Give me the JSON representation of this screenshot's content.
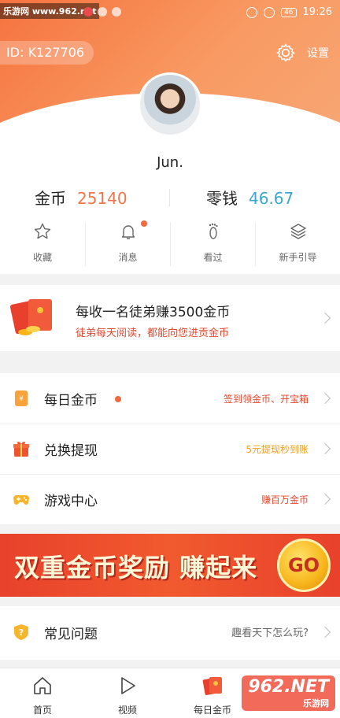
{
  "status_bar": {
    "watermark": "乐游网 www.962.net",
    "time": "19:26",
    "battery": "46"
  },
  "header": {
    "user_id": "ID: K127706",
    "settings_label": "设置"
  },
  "profile": {
    "username": "Jun.",
    "coins_label": "金币",
    "coins_value": "25140",
    "change_label": "零钱",
    "change_value": "46.67",
    "colors": {
      "coins": "#f0764c",
      "change": "#3ba7d4"
    }
  },
  "quick_actions": [
    {
      "label": "收藏",
      "icon": "star-icon"
    },
    {
      "label": "消息",
      "icon": "bell-icon"
    },
    {
      "label": "看过",
      "icon": "footprint-icon"
    },
    {
      "label": "新手引导",
      "icon": "layers-icon"
    }
  ],
  "invite": {
    "title": "每收一名徒弟赚3500金币",
    "subtitle": "徒弟每天阅读，都能向您进贡金币"
  },
  "menu": [
    {
      "label": "每日金币",
      "hint": "签到领金币、开宝箱",
      "hint_color": "#e04a2f",
      "icon": "coin-card-icon"
    },
    {
      "label": "兑换提现",
      "hint": "5元提现秒到账",
      "hint_color": "#f0a020",
      "icon": "gift-icon"
    },
    {
      "label": "游戏中心",
      "hint": "赚百万金币",
      "hint_color": "#e04a2f",
      "icon": "gamepad-icon"
    }
  ],
  "banner": {
    "text": "双重金币奖励 赚起来",
    "go": "GO"
  },
  "faq": {
    "label": "常见问题",
    "hint": "趣看天下怎么玩?",
    "icon": "question-shield-icon"
  },
  "tabbar": [
    {
      "label": "首页",
      "icon": "home-icon"
    },
    {
      "label": "视频",
      "icon": "play-icon"
    },
    {
      "label": "每日金币",
      "icon": "red-envelope-icon"
    }
  ],
  "watermark_962": {
    "big": "962.NET",
    "small": "乐游网"
  }
}
